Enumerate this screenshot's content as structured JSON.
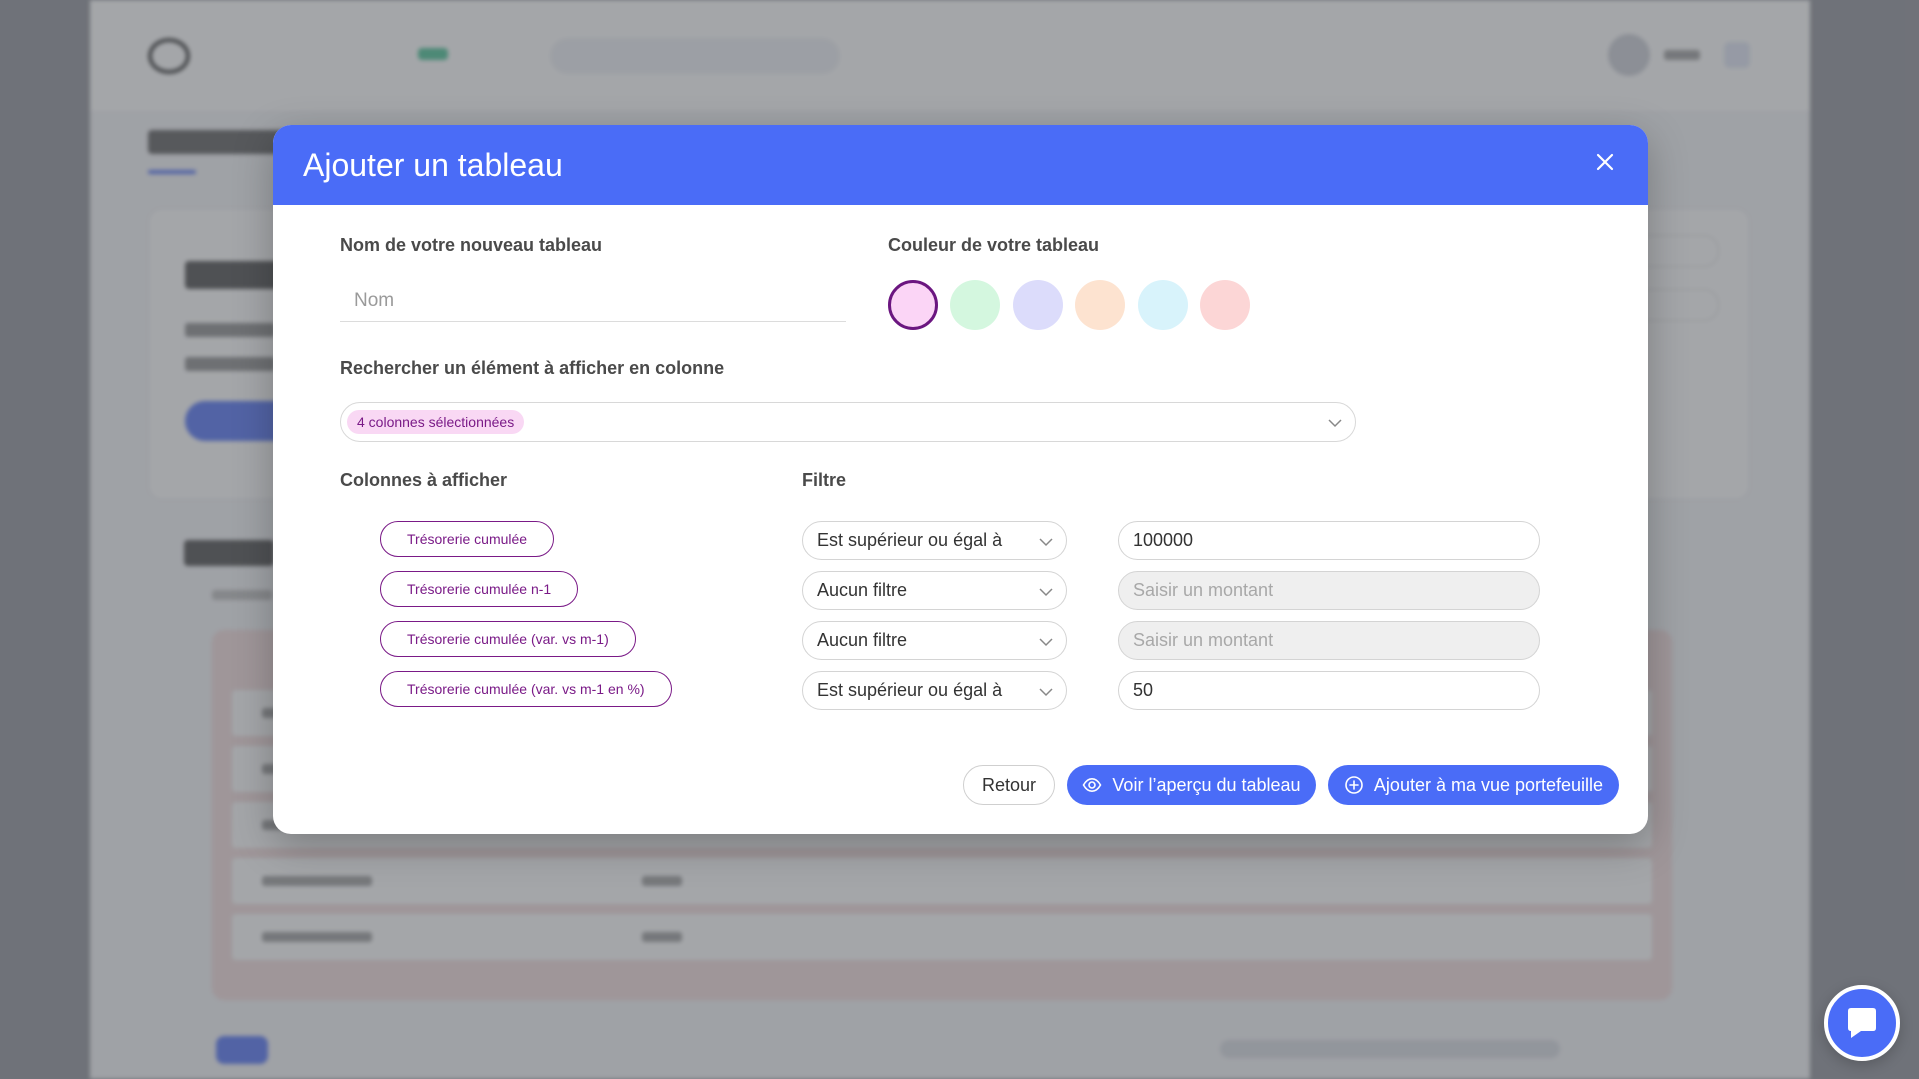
{
  "modal": {
    "title": "Ajouter un tableau",
    "name_label": "Nom de votre nouveau tableau",
    "name_placeholder": "Nom",
    "name_value": "",
    "color_label": "Couleur de votre tableau",
    "colors": [
      {
        "hex": "#fbd5f6",
        "selected": true
      },
      {
        "hex": "#d4f7df",
        "selected": false
      },
      {
        "hex": "#dcdcfb",
        "selected": false
      },
      {
        "hex": "#fde3d0",
        "selected": false
      },
      {
        "hex": "#d8f3fb",
        "selected": false
      },
      {
        "hex": "#fcd6d6",
        "selected": false
      }
    ],
    "search_label": "Rechercher un élément à afficher en colonne",
    "selected_tag": "4 colonnes sélectionnées",
    "columns_label": "Colonnes à afficher",
    "filter_label": "Filtre",
    "rows": [
      {
        "column": "Trésorerie cumulée",
        "filter": "Est supérieur ou égal à",
        "amount": "100000",
        "amount_placeholder": "Saisir un montant"
      },
      {
        "column": "Trésorerie cumulée n-1",
        "filter": "Aucun filtre",
        "amount": "",
        "amount_placeholder": "Saisir un montant"
      },
      {
        "column": "Trésorerie cumulée (var. vs m-1)",
        "filter": "Aucun filtre",
        "amount": "",
        "amount_placeholder": "Saisir un montant"
      },
      {
        "column": "Trésorerie cumulée (var. vs m-1 en %)",
        "filter": "Est supérieur ou égal à",
        "amount": "50",
        "amount_placeholder": "Saisir un montant"
      }
    ],
    "buttons": {
      "back": "Retour",
      "preview": "Voir l’aperçu du tableau",
      "add": "Ajouter à ma vue portefeuille"
    }
  },
  "colors": {
    "primary": "#4a6cf7",
    "accent_purple": "#7a1a87"
  },
  "icons": {
    "close": "close-icon",
    "chevron": "chevron-down-icon",
    "eye": "eye-icon",
    "plus_circle": "plus-circle-icon",
    "chat": "chat-icon"
  }
}
